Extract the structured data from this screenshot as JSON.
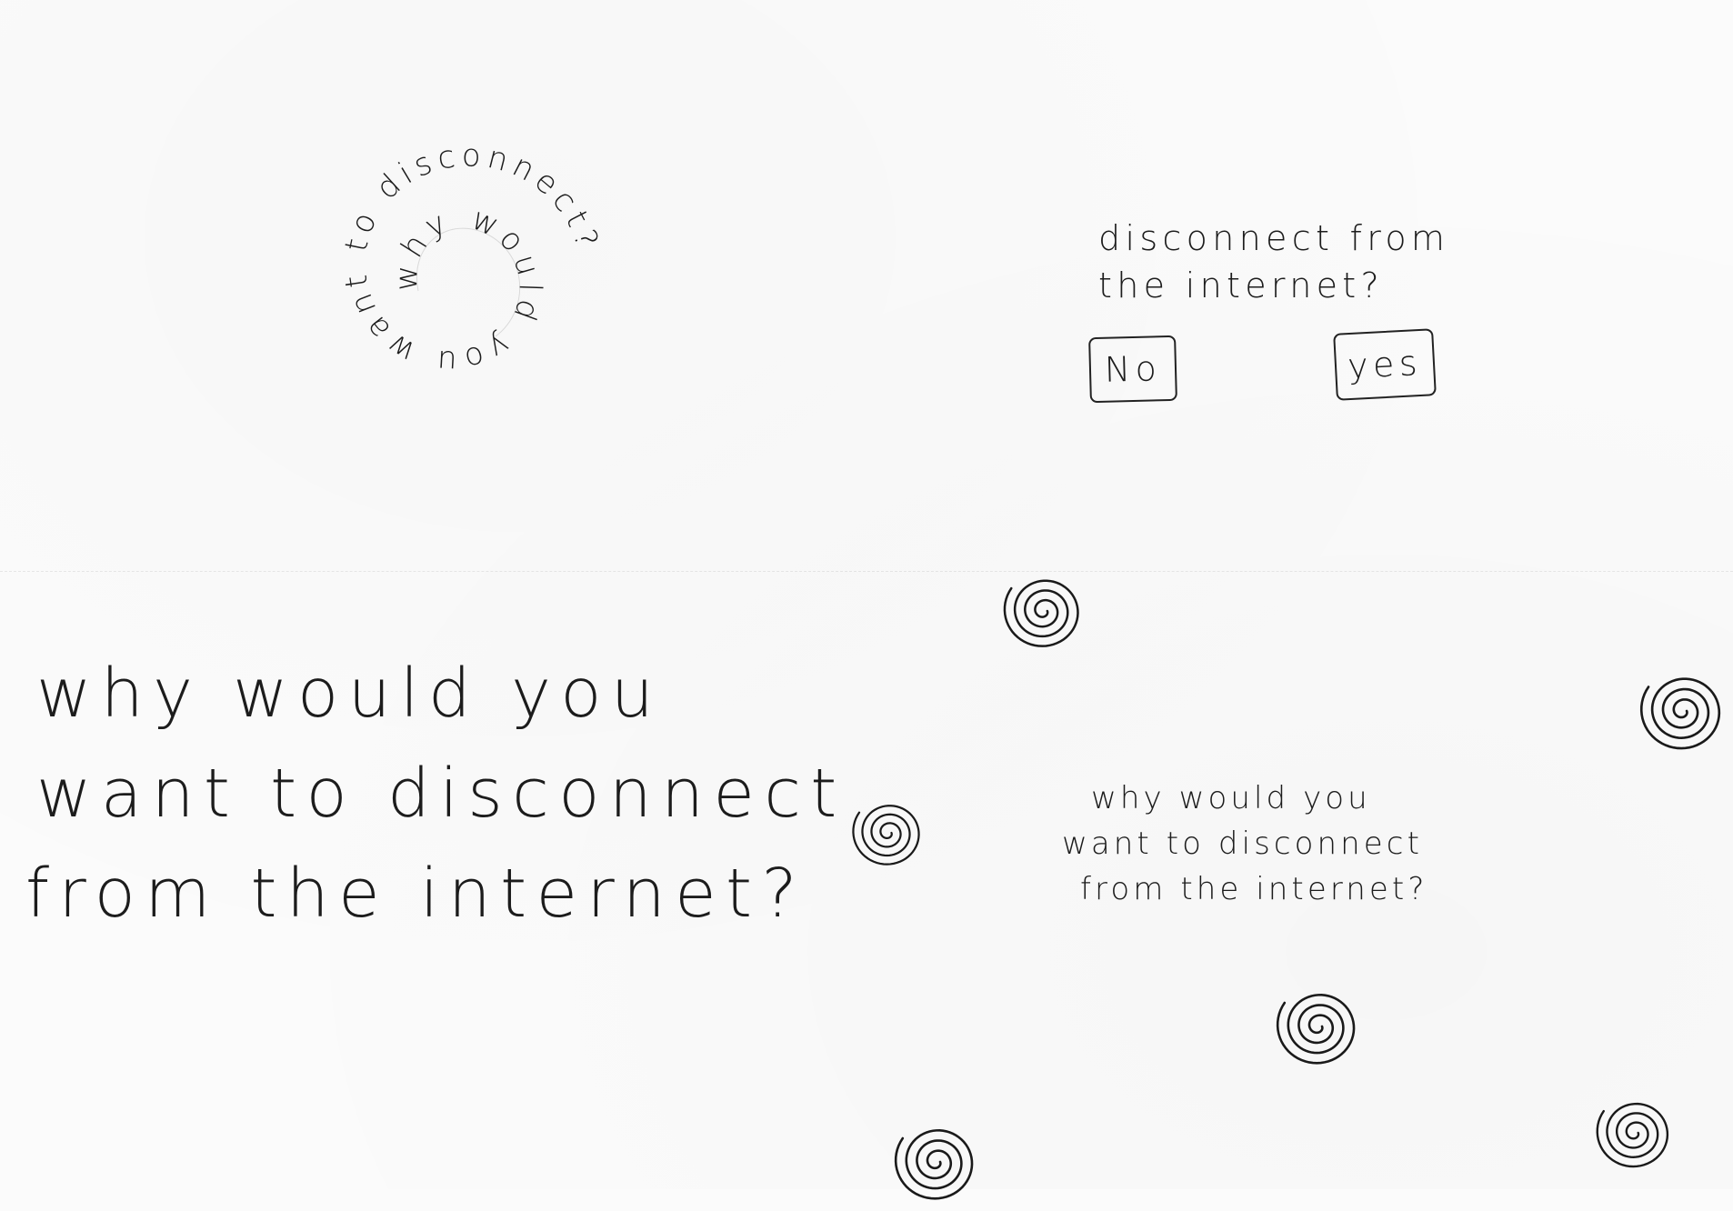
{
  "spiral": {
    "text": "why would you want to disconnect?"
  },
  "dialog": {
    "line1": "disconnect from",
    "line2": "the internet?",
    "no_label": "No",
    "yes_label": "yes"
  },
  "big_question": {
    "line1": "why would you",
    "line2": "want to disconnect",
    "line3": "from the internet?"
  },
  "small_question": {
    "line1": "why would you",
    "line2": "want to disconnect",
    "line3": "from the internet?"
  },
  "doodles": [
    "spiral-doodle",
    "spiral-doodle",
    "spiral-doodle",
    "spiral-doodle",
    "spiral-doodle",
    "spiral-doodle"
  ],
  "colors": {
    "paper": "#fbfbfb",
    "pencil": "#1c1c1c"
  }
}
